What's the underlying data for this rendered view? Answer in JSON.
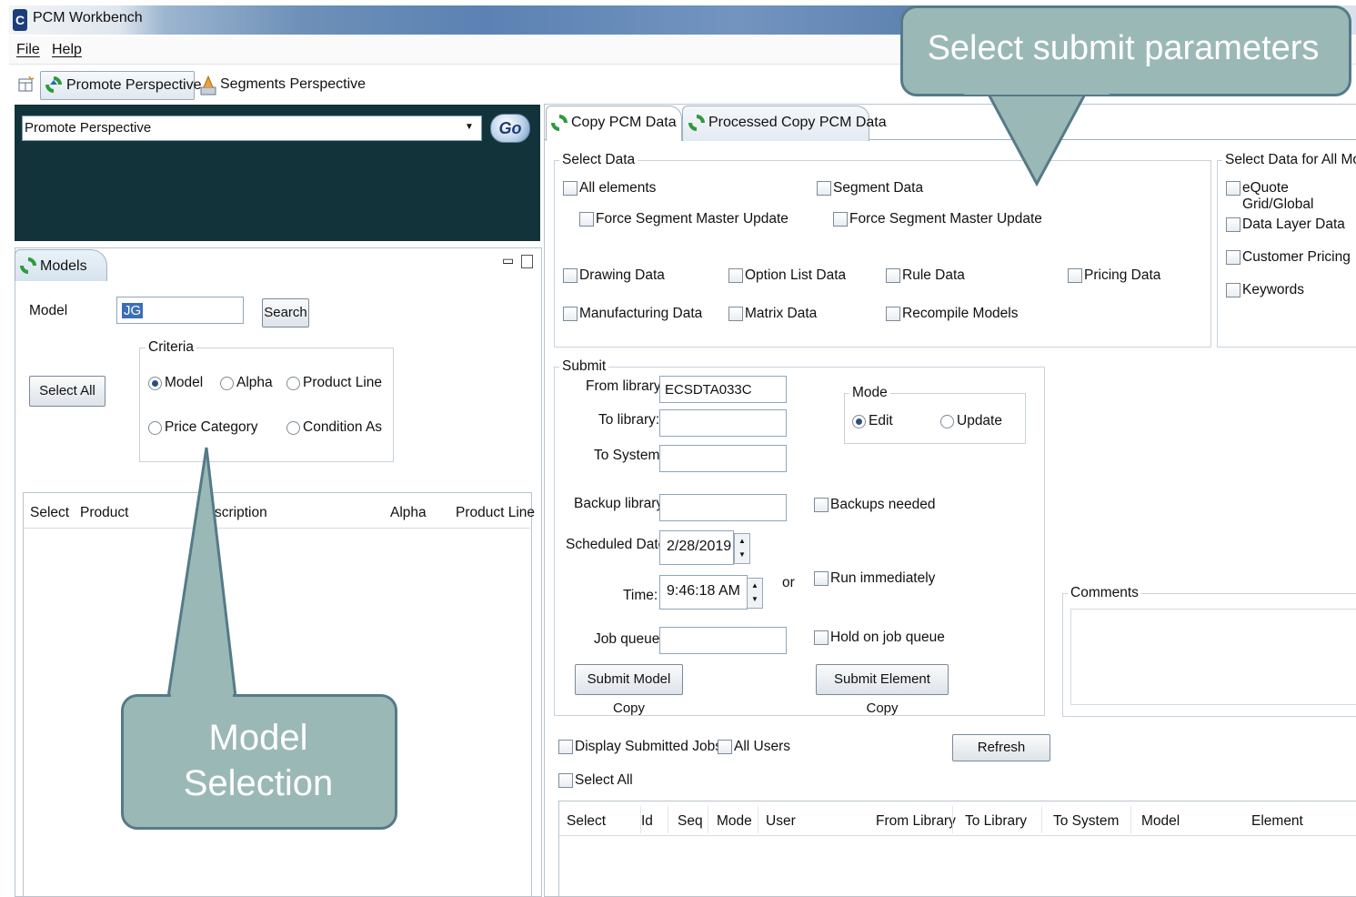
{
  "window": {
    "title": "PCM Workbench"
  },
  "menu": [
    "File",
    "Help"
  ],
  "perspectives": {
    "promote": "Promote Perspective",
    "segments": "Segments Perspective"
  },
  "perspective_combo": {
    "value": "Promote Perspective",
    "go": "Go"
  },
  "models_panel": {
    "tab": "Models",
    "model_label": "Model",
    "model_value": "JG",
    "search": "Search",
    "select_all": "Select All",
    "criteria": {
      "legend": "Criteria",
      "options": [
        "Model",
        "Alpha",
        "Product Line",
        "Price Category",
        "Condition As"
      ],
      "selected": "Model"
    },
    "table_columns": [
      "Select",
      "Product",
      "scription",
      "Alpha",
      "Product Line"
    ]
  },
  "tabs": [
    "Copy PCM Data",
    "Processed Copy PCM Data"
  ],
  "select_data": {
    "legend": "Select Data",
    "all_elements": "All elements",
    "force_segment_master_update_1": "Force Segment Master Update",
    "segment_data": "Segment Data",
    "force_segment_master_update_2": "Force Segment Master Update",
    "drawing_data": "Drawing Data",
    "option_list_data": "Option List Data",
    "rule_data": "Rule Data",
    "pricing_data": "Pricing Data",
    "manufacturing_data": "Manufacturing Data",
    "matrix_data": "Matrix Data",
    "recompile_models": "Recompile Models"
  },
  "all_models": {
    "legend": "Select Data for All Models",
    "items": [
      "eQuote Grid/Global",
      "Data Layer Data",
      "Customer Pricing",
      "Keywords"
    ]
  },
  "submit": {
    "legend": "Submit",
    "from_library_label": "From library:",
    "from_library_value": "ECSDTA033C",
    "to_library_label": "To library:",
    "to_system_label": "To System:",
    "backup_library_label": "Backup library:",
    "scheduled_date_label": "Scheduled Date:",
    "scheduled_date_value": "2/28/2019",
    "time_label": "Time:",
    "time_value": "9:46:18 AM",
    "or": "or",
    "job_queue_label": "Job queue:",
    "backups_needed": "Backups needed",
    "run_immediately": "Run immediately",
    "hold_on_job_queue": "Hold on job queue",
    "submit_model_copy": "Submit Model Copy",
    "submit_element_copy": "Submit Element Copy",
    "mode": {
      "legend": "Mode",
      "edit": "Edit",
      "update": "Update",
      "selected": "Edit"
    }
  },
  "comments": {
    "legend": "Comments"
  },
  "jobs": {
    "display_submitted_jobs": "Display Submitted Jobs",
    "all_users": "All Users",
    "refresh": "Refresh",
    "select_all": "Select All",
    "columns": [
      "Select",
      "Id",
      "Seq",
      "Mode",
      "User",
      "From Library",
      "To Library",
      "To System",
      "Model",
      "Element"
    ]
  },
  "callouts": {
    "submit_params": "Select submit parameters",
    "model_selection_line1": "Model",
    "model_selection_line2": "Selection"
  },
  "colors": {
    "dark_panel": "#123339",
    "callout_fill": "#9ab8b6",
    "callout_border": "#557a88"
  },
  "icons": [
    "app-icon",
    "promote-arrows-icon",
    "segments-icon",
    "perspective-open-icon",
    "minimize-icon",
    "maximize-icon"
  ]
}
